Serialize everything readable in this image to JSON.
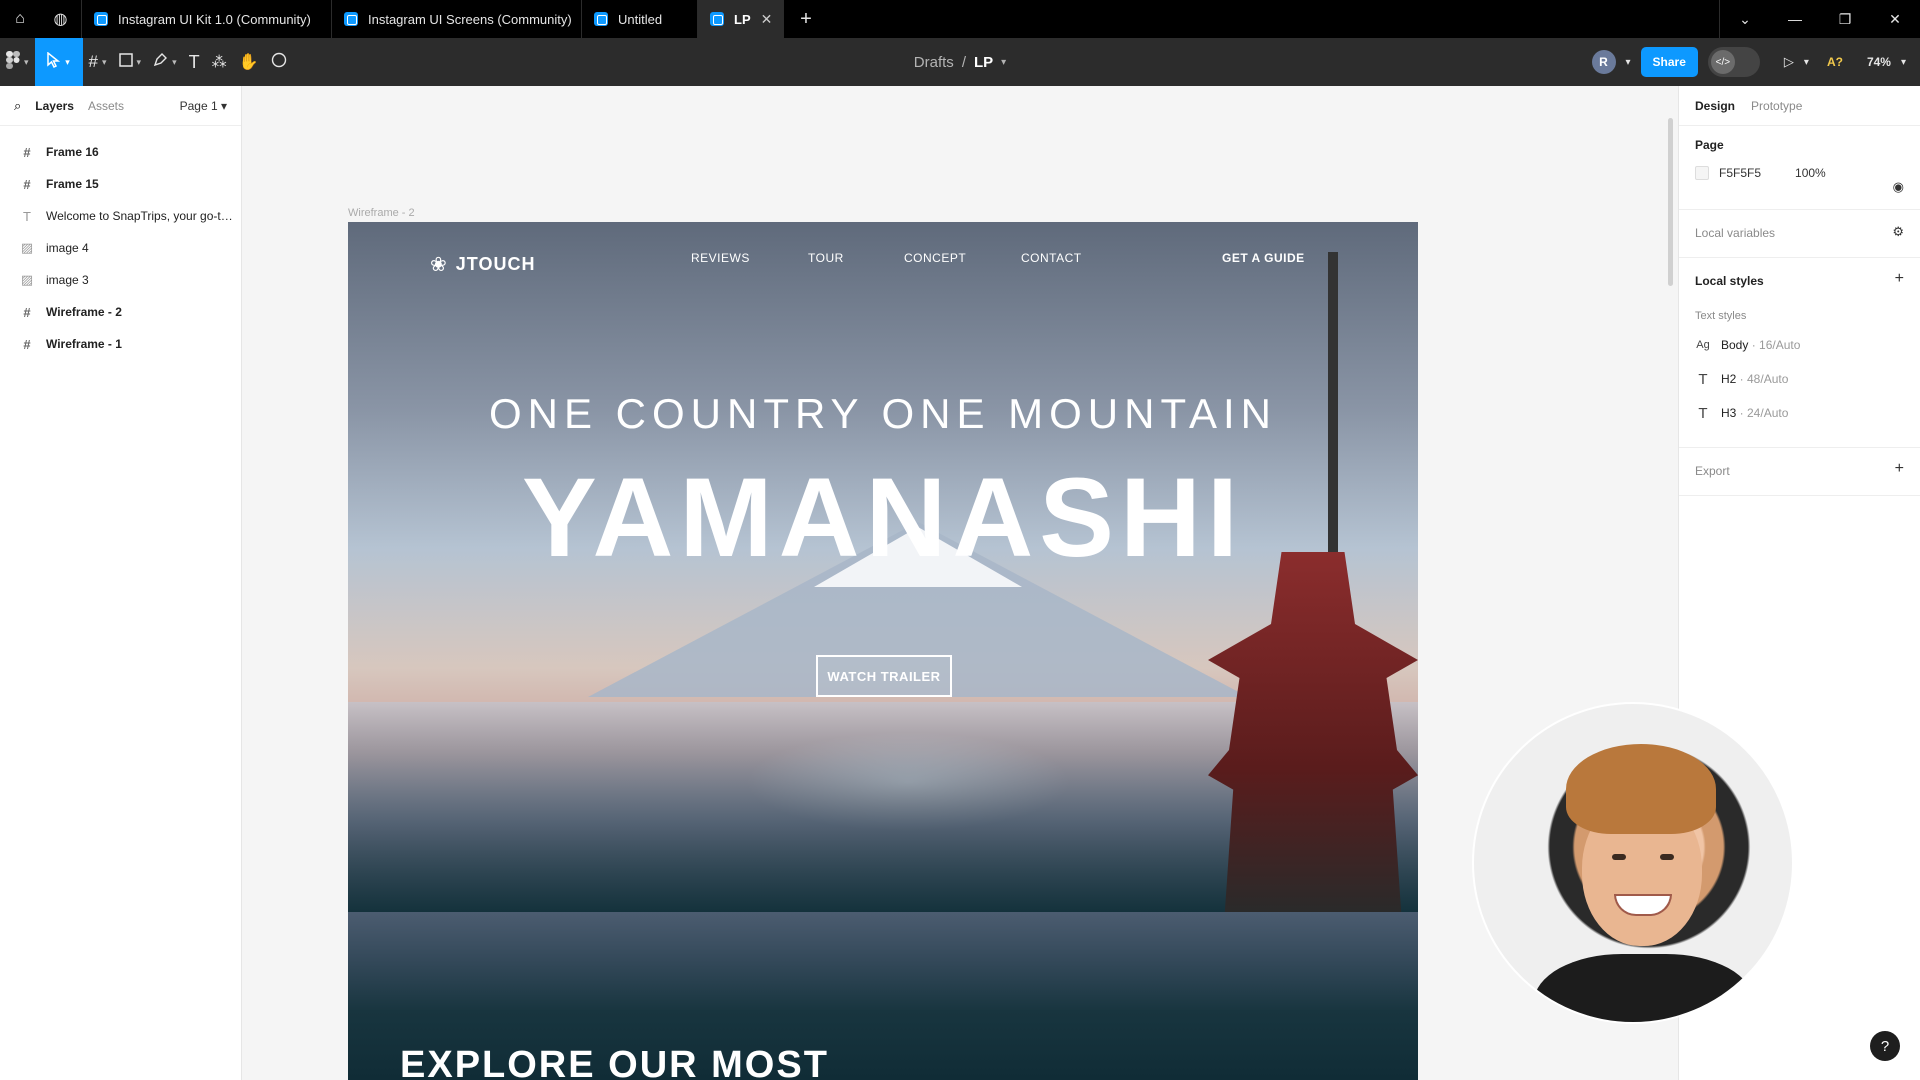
{
  "tabs": [
    {
      "label": "Instagram UI Kit 1.0 (Community)"
    },
    {
      "label": "Instagram UI Screens (Community)"
    },
    {
      "label": "Untitled"
    },
    {
      "label": "LP"
    }
  ],
  "breadcrumb": {
    "parent": "Drafts",
    "separator": "/",
    "current": "LP"
  },
  "toolbar": {
    "user_initial": "R",
    "share_label": "Share",
    "ai_label": "A?",
    "zoom": "74%"
  },
  "left_panel": {
    "tabs": {
      "layers": "Layers",
      "assets": "Assets",
      "page": "Page 1"
    },
    "layers": [
      {
        "name": "Frame 16",
        "type": "frame"
      },
      {
        "name": "Frame 15",
        "type": "frame"
      },
      {
        "name": "Welcome to SnapTrips, your go-to ...",
        "type": "text"
      },
      {
        "name": "image 4",
        "type": "image"
      },
      {
        "name": "image 3",
        "type": "image"
      },
      {
        "name": "Wireframe - 2",
        "type": "frame"
      },
      {
        "name": "Wireframe - 1",
        "type": "frame"
      }
    ]
  },
  "right_panel": {
    "tabs": {
      "design": "Design",
      "prototype": "Prototype"
    },
    "page_title": "Page",
    "page_color": "F5F5F5",
    "page_opacity": "100%",
    "local_variables": "Local variables",
    "local_styles": "Local styles",
    "text_styles_title": "Text styles",
    "text_styles": [
      {
        "name": "Body",
        "meta": " · 16/Auto",
        "icon": "Ag"
      },
      {
        "name": "H2",
        "meta": " · 48/Auto",
        "icon": "T"
      },
      {
        "name": "H3",
        "meta": " · 24/Auto",
        "icon": "T"
      }
    ],
    "export": "Export"
  },
  "canvas": {
    "frame_label": "Wireframe - 2",
    "logo": "JTOUCH",
    "nav": [
      "REVIEWS",
      "TOUR",
      "CONCEPT",
      "CONTACT"
    ],
    "cta": "GET A GUIDE",
    "subtitle": "ONE COUNTRY ONE MOUNTAIN",
    "title": "YAMANASHI",
    "button": "WATCH TRAILER",
    "section_heading": "EXPLORE OUR MOST"
  },
  "help": "?",
  "colors": {
    "accent": "#0d99ff",
    "toolbar": "#2c2c2c",
    "canvas": "#f5f5f5"
  }
}
